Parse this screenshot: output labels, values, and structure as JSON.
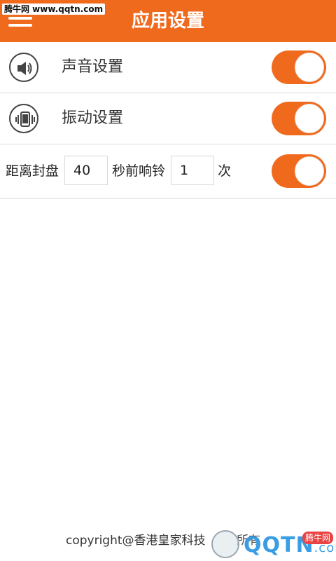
{
  "header": {
    "title": "应用设置",
    "menu_icon": "hamburger-menu-icon",
    "accent_color": "#f06a1e"
  },
  "watermark_top": "腾牛网 www.qqtn.com",
  "settings": {
    "sound": {
      "icon": "speaker-icon",
      "label": "声音设置",
      "enabled": true
    },
    "vibrate": {
      "icon": "vibrate-phone-icon",
      "label": "振动设置",
      "enabled": true
    },
    "ring": {
      "prefix": "距离封盘",
      "seconds_value": "40",
      "middle": "秒前响铃",
      "times_value": "1",
      "suffix": "次",
      "enabled": true
    }
  },
  "footer": {
    "copyright": "copyright@香港皇家科技",
    "rights": "所有"
  },
  "watermark_bottom": {
    "brand": "QQTN",
    "domain": ".com",
    "badge": "腾牛网"
  }
}
